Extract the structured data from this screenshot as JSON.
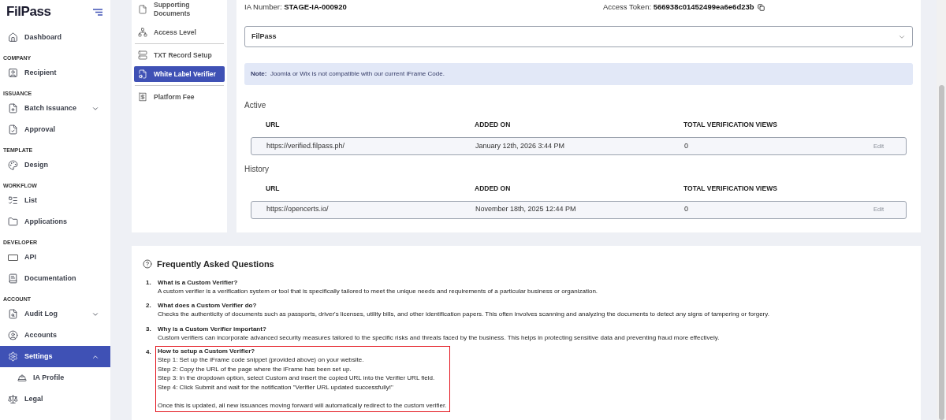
{
  "logo": {
    "text": "FilPass"
  },
  "sidebar": {
    "sections": [
      {
        "items": [
          {
            "label": "Dashboard",
            "selected": false
          }
        ]
      },
      {
        "heading": "COMPANY",
        "items": [
          {
            "label": "Recipient",
            "selected": false
          }
        ]
      },
      {
        "heading": "ISSUANCE",
        "items": [
          {
            "label": "Batch Issuance",
            "selected": false,
            "expanded": false
          },
          {
            "label": "Approval",
            "selected": false
          }
        ]
      },
      {
        "heading": "TEMPLATE",
        "items": [
          {
            "label": "Design",
            "selected": false
          }
        ]
      },
      {
        "heading": "WORKFLOW",
        "items": [
          {
            "label": "List",
            "selected": false
          },
          {
            "label": "Applications",
            "selected": false
          }
        ]
      },
      {
        "heading": "DEVELOPER",
        "items": [
          {
            "label": "API",
            "selected": false
          },
          {
            "label": "Documentation",
            "selected": false
          }
        ]
      },
      {
        "heading": "ACCOUNT",
        "items": [
          {
            "label": "Audit Log",
            "selected": false,
            "expanded": false
          },
          {
            "label": "Accounts",
            "selected": false
          },
          {
            "label": "Settings",
            "selected": true,
            "expanded": true,
            "children": [
              {
                "label": "IA Profile",
                "selected": false
              }
            ]
          },
          {
            "label": "Legal",
            "selected": false
          }
        ]
      }
    ]
  },
  "settings_nav": [
    {
      "label": "Supporting Documents",
      "selected": false
    },
    {
      "label": "Access Level",
      "selected": false
    },
    {
      "label": "TXT Record Setup",
      "selected": false
    },
    {
      "label": "White Label Verifier",
      "selected": true
    },
    {
      "label": "Platform Fee",
      "selected": false
    }
  ],
  "ia_number": {
    "label": "IA Number:",
    "value": "STAGE-IA-000920"
  },
  "access_token": {
    "label": "Access Token:",
    "value": "566938c01452499ea6e6d23b"
  },
  "verifier_select": {
    "value": "FilPass"
  },
  "note": {
    "label": "Note:",
    "text": "Joomla or Wix is not compatible with our current iFrame Code."
  },
  "tables": [
    {
      "title": "Active",
      "columns": [
        "URL",
        "ADDED ON",
        "TOTAL VERIFICATION VIEWS"
      ],
      "rows": [
        {
          "url": "https://verified.filpass.ph/",
          "added_on": "January 12th, 2026 3:44 PM",
          "views": "0",
          "action": "Edit",
          "action_disabled": true
        }
      ]
    },
    {
      "title": "History",
      "columns": [
        "URL",
        "ADDED ON",
        "TOTAL VERIFICATION VIEWS"
      ],
      "rows": [
        {
          "url": "https://opencerts.io/",
          "added_on": "November 18th, 2025 12:44 PM",
          "views": "0",
          "action": "Edit",
          "action_disabled": true
        }
      ]
    }
  ],
  "faq": {
    "title": "Frequently Asked Questions",
    "items": [
      {
        "number": "1.",
        "question": "What is a Custom Verifier?",
        "answer": [
          "A custom verifier is a verification system or tool that is specifically tailored to meet the unique needs and requirements of a particular business or organization."
        ],
        "highlighted": false
      },
      {
        "number": "2.",
        "question": "What does a Custom Verifier do?",
        "answer": [
          "Checks the authenticity of documents such as passports, driver's licenses, utility bills, and other identification papers. This often involves scanning and analyzing the documents to detect any signs of tampering or forgery."
        ],
        "highlighted": false
      },
      {
        "number": "3.",
        "question": "Why is a Custom Verifier important?",
        "answer": [
          "Custom verifiers can incorporate advanced security measures tailored to the specific risks and threats faced by the business. This helps in protecting sensitive data and preventing fraud more effectively."
        ],
        "highlighted": false
      },
      {
        "number": "4.",
        "question": "How to setup a Custom Verifier?",
        "answer": [
          "Step 1: Set up the iFrame code snippet (provided above) on your website.",
          "Step 2: Copy the URL of the page where the iFrame has been set up.",
          "Step 3: In the dropdown option, select Custom and insert the copied URL into the Verifier URL field.",
          "Step 4: Click Submit and wait for the notification \"Verifier URL updated successfully!\""
        ],
        "closing": "Once this is updated, all new issuances moving forward will automatically redirect to the custom verifier.",
        "highlighted": true
      }
    ]
  }
}
